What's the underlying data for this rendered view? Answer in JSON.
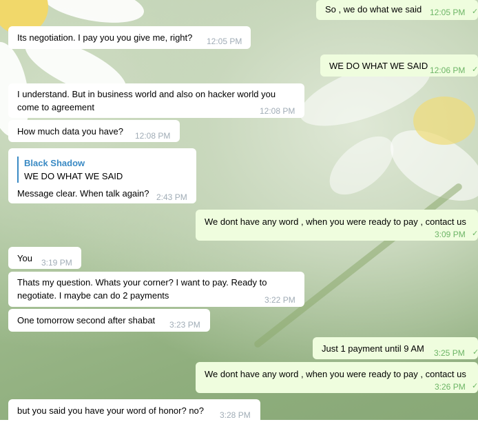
{
  "messages": [
    {
      "dir": "out",
      "text": "So , we do what we said",
      "time": "12:05 PM"
    },
    {
      "dir": "in",
      "text": "Its negotiation. I pay you you give me, right?",
      "time": "12:05 PM"
    },
    {
      "dir": "out",
      "text": "WE DO WHAT WE SAID",
      "time": "12:06 PM"
    },
    {
      "dir": "in",
      "text_line1": "I understand. But in business world and also on hacker world you",
      "text_line2": "come to agreement",
      "time": "12:08 PM"
    },
    {
      "dir": "in",
      "text": "How much data you have?",
      "time": "12:08 PM"
    },
    {
      "dir": "in",
      "reply_name": "Black Shadow",
      "reply_text": "WE DO WHAT WE SAID",
      "text": "Message clear. When talk again?",
      "time": "2:43 PM"
    },
    {
      "dir": "out",
      "text": "We dont have any word , when you were ready to pay , contact us",
      "time": "3:09 PM"
    },
    {
      "dir": "in",
      "text": "You",
      "time": "3:19 PM"
    },
    {
      "dir": "in",
      "text_line1": "Thats my question. Whats your corner? I want to pay. Ready to",
      "text_line2": "negotiate. I maybe can do 2 payments",
      "time": "3:22 PM"
    },
    {
      "dir": "in",
      "text": "One tomorrow second after shabat",
      "time": "3:23 PM"
    },
    {
      "dir": "out",
      "text": "Just 1 payment until 9 AM",
      "time": "3:25 PM"
    },
    {
      "dir": "out",
      "text": "We dont have any word , when you were ready to pay , contact us",
      "time": "3:26 PM"
    },
    {
      "dir": "in",
      "text": "but you said you have your word of honor? no?",
      "time": "3:28 PM"
    }
  ],
  "icons": {
    "read_check": "check-icon"
  },
  "colors": {
    "incoming_bg": "#ffffff",
    "outgoing_bg": "#effdde",
    "outgoing_time": "#6db566",
    "incoming_time": "#a0acb6",
    "reply_accent": "#3a8ac4"
  }
}
